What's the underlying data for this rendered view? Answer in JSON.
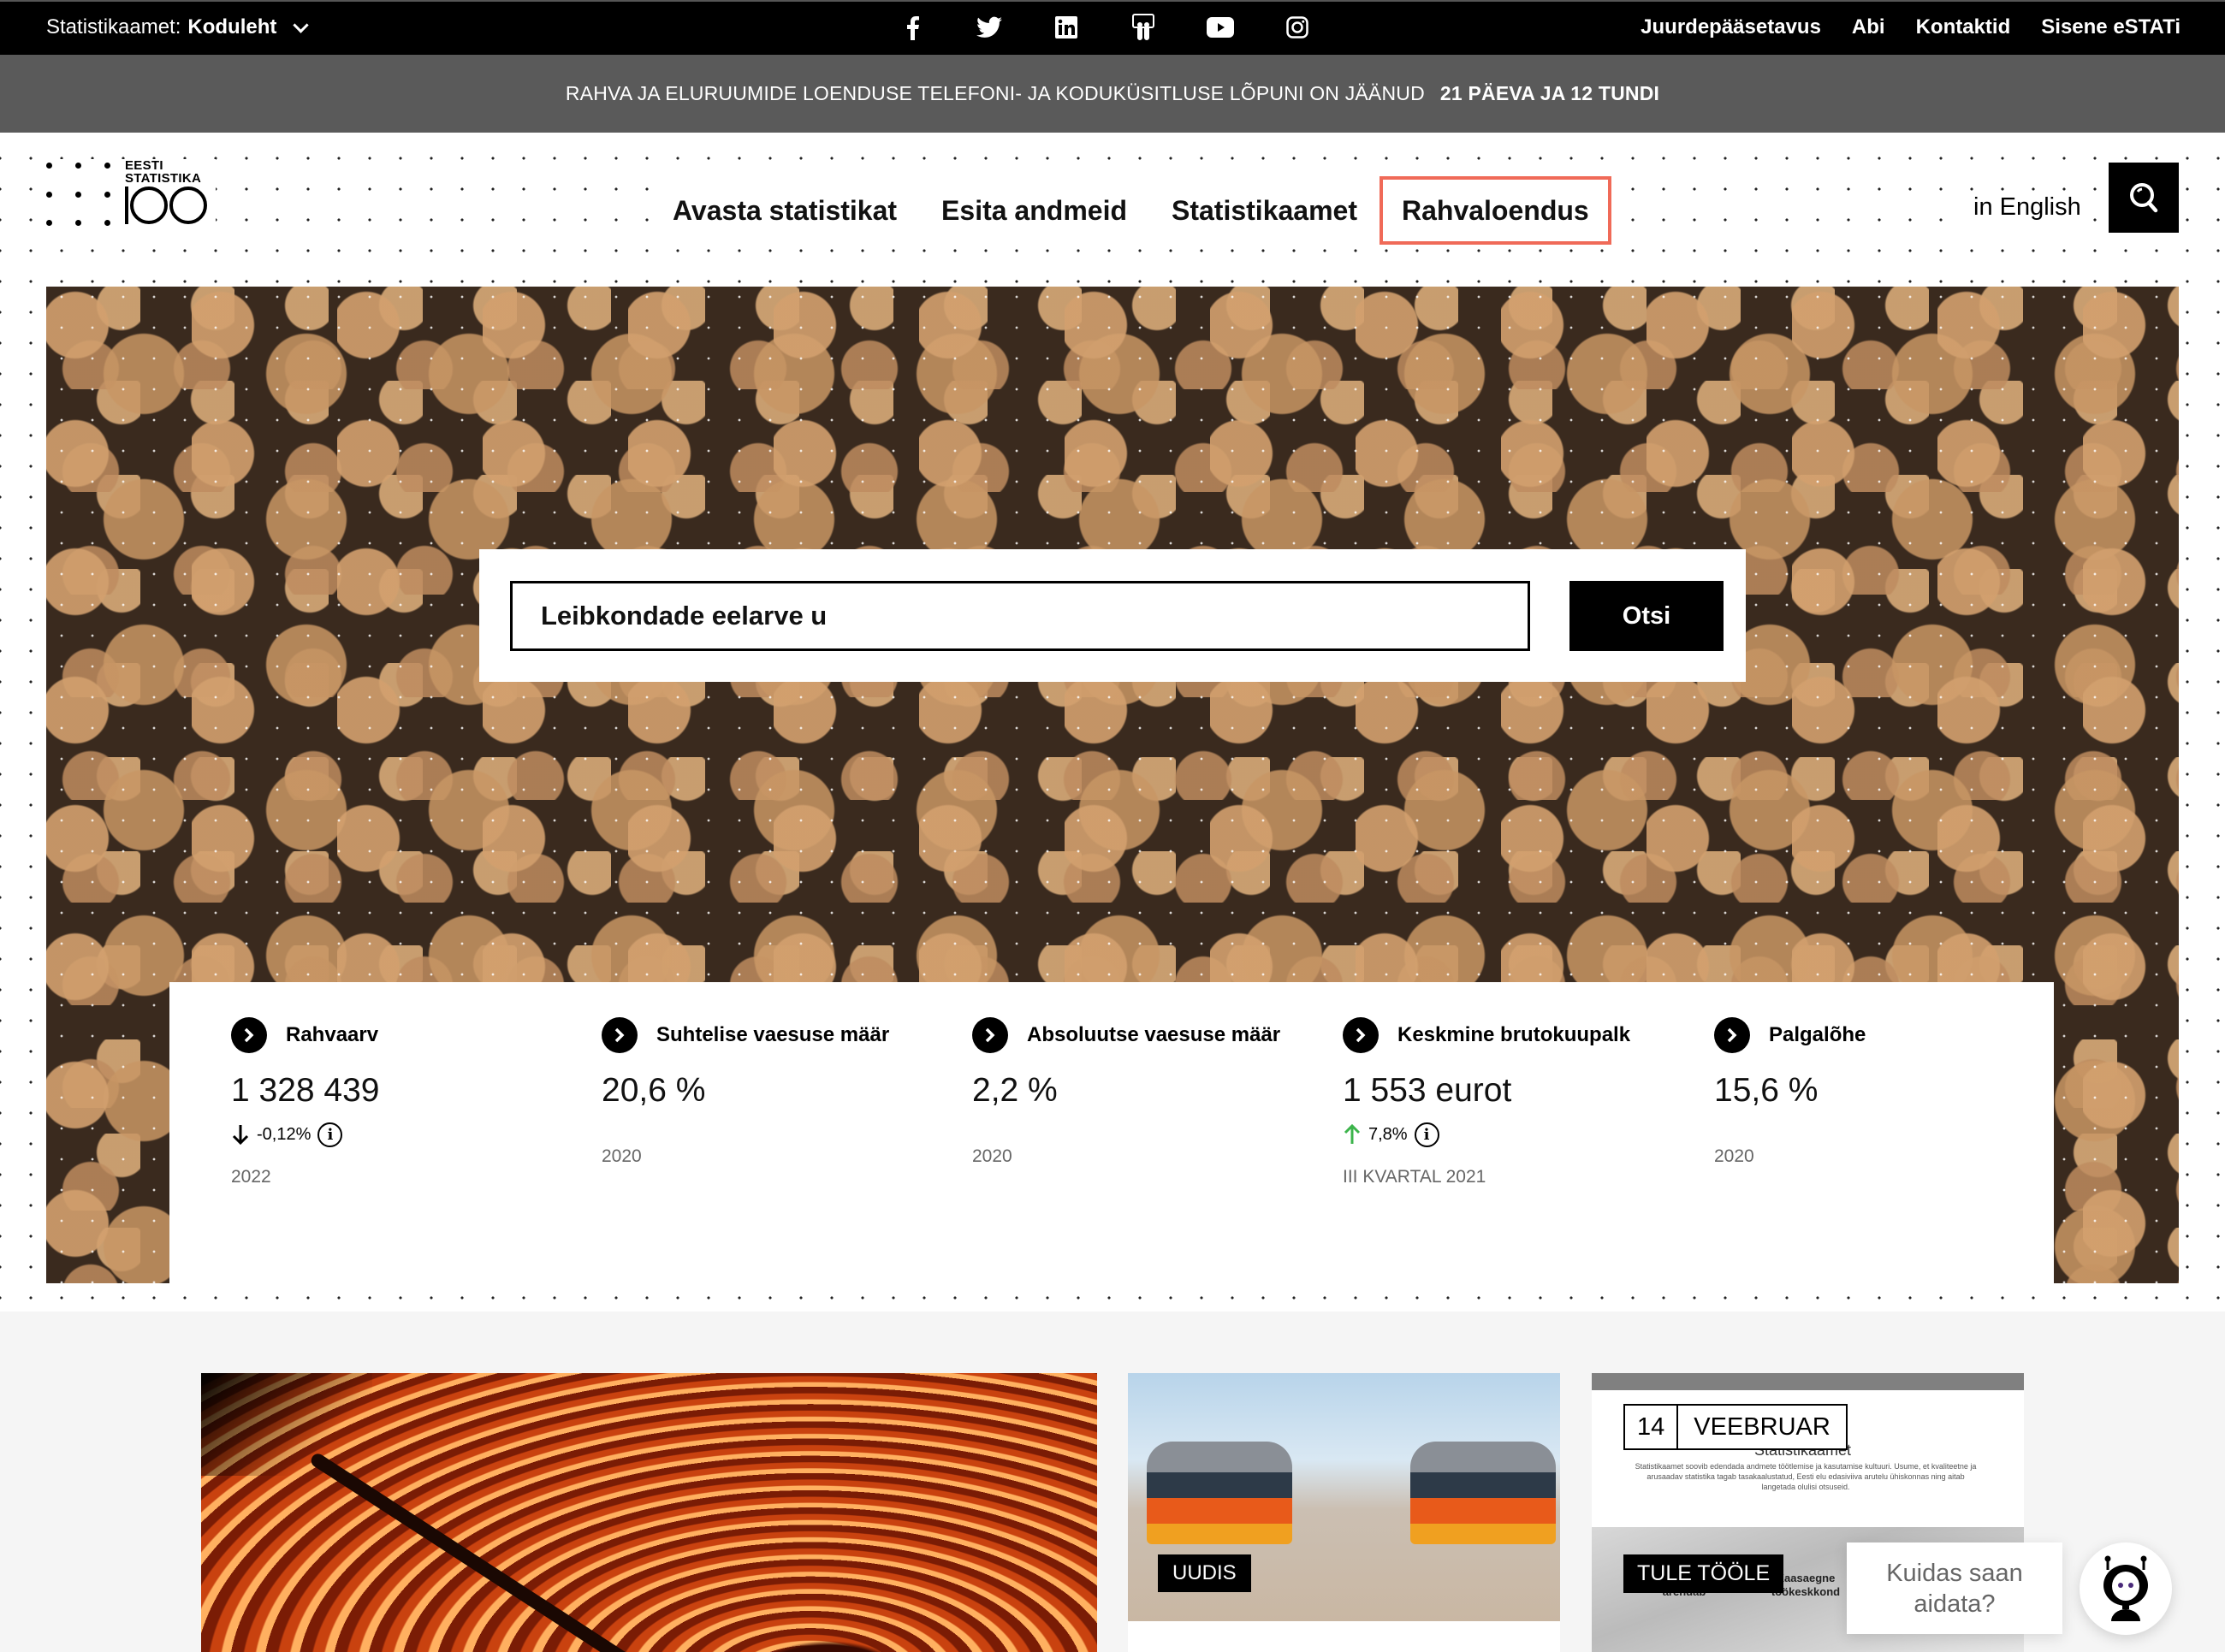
{
  "topbar": {
    "site_prefix": "Statistikaamet:",
    "site_current": "Koduleht",
    "social_icons": [
      "facebook-icon",
      "twitter-icon",
      "linkedin-icon",
      "slideshare-icon",
      "youtube-icon",
      "instagram-icon"
    ],
    "links": [
      "Juurdepääsetavus",
      "Abi",
      "Kontaktid",
      "Sisene eSTATi"
    ]
  },
  "announcement": {
    "text": "RAHVA JA ELURUUMIDE LOENDUSE TELEFONI- JA KODUKÜSITLUSE LÕPUNI ON JÄÄNUD",
    "countdown": "21 PÄEVA JA 12 TUNDI"
  },
  "logo": {
    "line1": "EESTI",
    "line2": "STATISTIKA",
    "number": "100"
  },
  "nav": {
    "items": [
      {
        "label": "Avasta statistikat",
        "active": false
      },
      {
        "label": "Esita andmeid",
        "active": false
      },
      {
        "label": "Statistikaamet",
        "active": false
      },
      {
        "label": "Rahvaloendus",
        "active": true
      }
    ],
    "language": "in English",
    "active_border_color": "#f06a58"
  },
  "search": {
    "value": "Leibkondade eelarve u",
    "button": "Otsi"
  },
  "stats": [
    {
      "title": "Rahvaarv",
      "value": "1 328 439",
      "change": "-0,12%",
      "direction": "down",
      "period": "2022"
    },
    {
      "title": "Suhtelise vaesuse määr",
      "value": "20,6 %",
      "change": null,
      "direction": null,
      "period": "2020"
    },
    {
      "title": "Absoluutse vaesuse määr",
      "value": "2,2 %",
      "change": null,
      "direction": null,
      "period": "2020"
    },
    {
      "title": "Keskmine brutokuupalk",
      "value": "1 553 eurot",
      "change": "7,8%",
      "direction": "up",
      "period": "III KVARTAL 2021"
    },
    {
      "title": "Palgalõhe",
      "value": "15,6 %",
      "change": null,
      "direction": null,
      "period": "2020"
    }
  ],
  "colors": {
    "up": "#3cb44b",
    "down": "#000000"
  },
  "cards": {
    "news_tag": "UUDIS",
    "event_day": "14",
    "event_month": "VEEBRUAR",
    "event_ghost_title": "Statistikaamet",
    "event_ghost_body": "Statistikaamet soovib edendada andmete töötlemise ja kasutamise kultuuri. Usume, et kvaliteetne ja arusaadav statistika tagab tasakaalustatud, Eesti elu edasiviiva arutelu ühiskonnas ning aitab langetada olulisi otsuseid.",
    "job_tag": "TULE TÖÖLE",
    "job_sub1": "arendab",
    "job_sub2": "Kaasaegne töökeskkond"
  },
  "chat": {
    "prompt": "Kuidas saan aidata?"
  }
}
